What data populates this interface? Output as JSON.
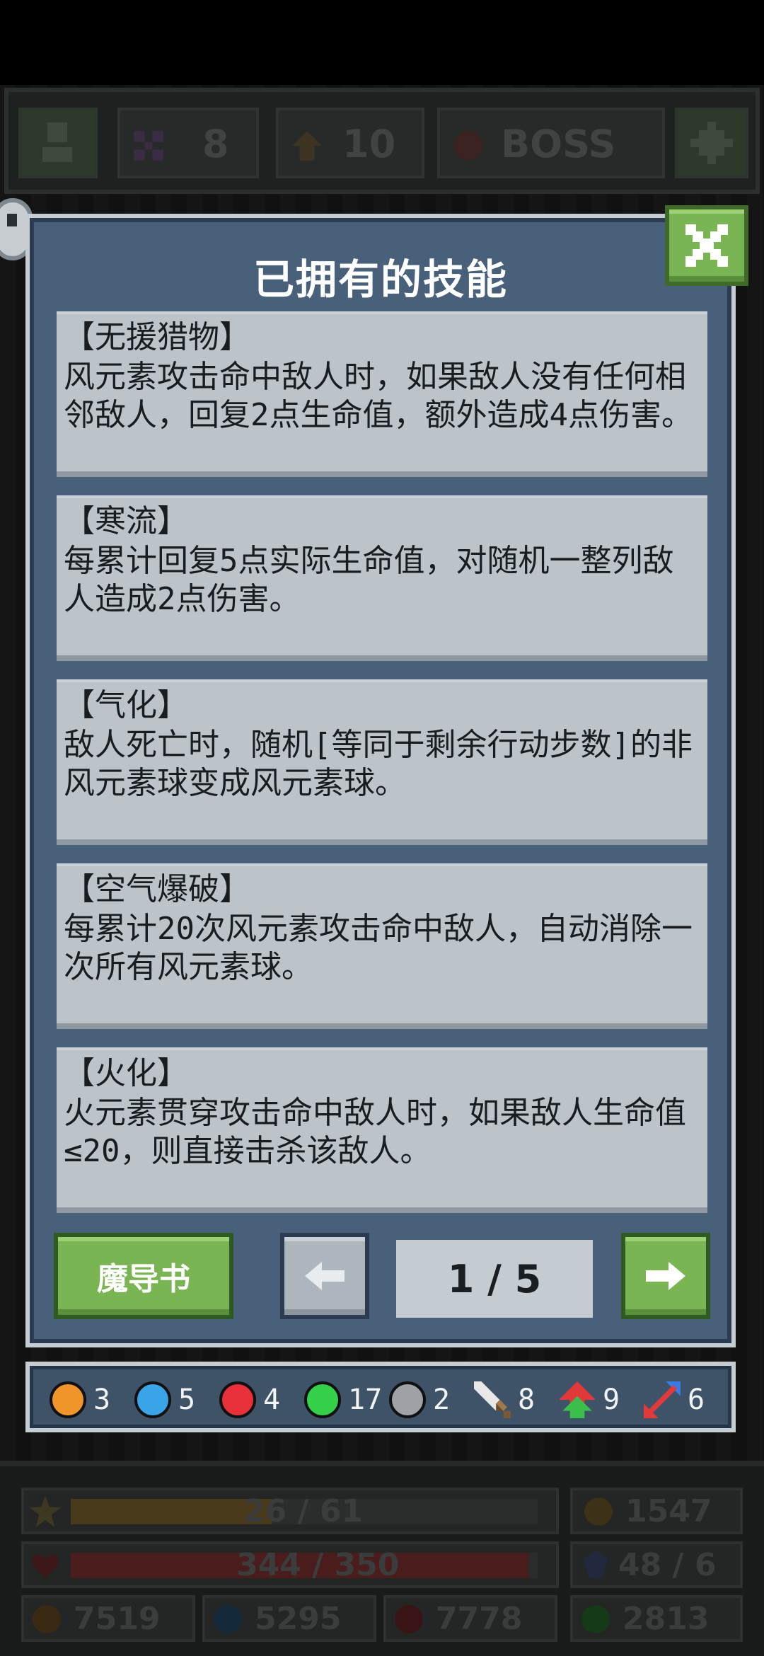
{
  "topbar": {
    "count_1": "8",
    "count_2": "10",
    "boss_label": "BOSS"
  },
  "dialog": {
    "title": "已拥有的技能",
    "skills": [
      {
        "name": "【无援猎物】",
        "desc": "风元素攻击命中敌人时，如果敌人没有任何相邻敌人，回复2点生命值，额外造成4点伤害。"
      },
      {
        "name": "【寒流】",
        "desc": "每累计回复5点实际生命值，对随机一整列敌人造成2点伤害。"
      },
      {
        "name": "【气化】",
        "desc": "敌人死亡时，随机[等同于剩余行动步数]的非风元素球变成风元素球。"
      },
      {
        "name": "【空气爆破】",
        "desc": "每累计20次风元素攻击命中敌人，自动消除一次所有风元素球。"
      },
      {
        "name": "【火化】",
        "desc": "火元素贯穿攻击命中敌人时，如果敌人生命值≤20，则直接击杀该敌人。"
      }
    ],
    "grimoire_label": "魔导书",
    "page_indicator": "1 / 5"
  },
  "resources": [
    {
      "icon": "orange-orb-icon",
      "color": "#f0952a",
      "count": "3"
    },
    {
      "icon": "blue-orb-icon",
      "color": "#3aa4e8",
      "count": "5"
    },
    {
      "icon": "red-orb-icon",
      "color": "#e8303a",
      "count": "4"
    },
    {
      "icon": "green-orb-icon",
      "color": "#35d04a",
      "count": "17"
    },
    {
      "icon": "grey-orb-icon",
      "color": "#9ea2a6",
      "count": "2"
    },
    {
      "icon": "sword-icon",
      "color": "#e8e8e8",
      "count": "8"
    },
    {
      "icon": "upgrade-arrow-icon",
      "color": "#e23a3a",
      "count": "9"
    },
    {
      "icon": "swap-arrows-icon",
      "color": "#3a7ae2",
      "count": "6"
    }
  ],
  "hud": {
    "xp_text": "26 / 61",
    "xp_fraction": 0.43,
    "gold": "1547",
    "hp_text": "344 / 350",
    "hp_fraction": 0.98,
    "armor": "48 / 6",
    "stat_1": "7519",
    "stat_2": "5295",
    "stat_3": "7778",
    "stat_4": "2813"
  }
}
